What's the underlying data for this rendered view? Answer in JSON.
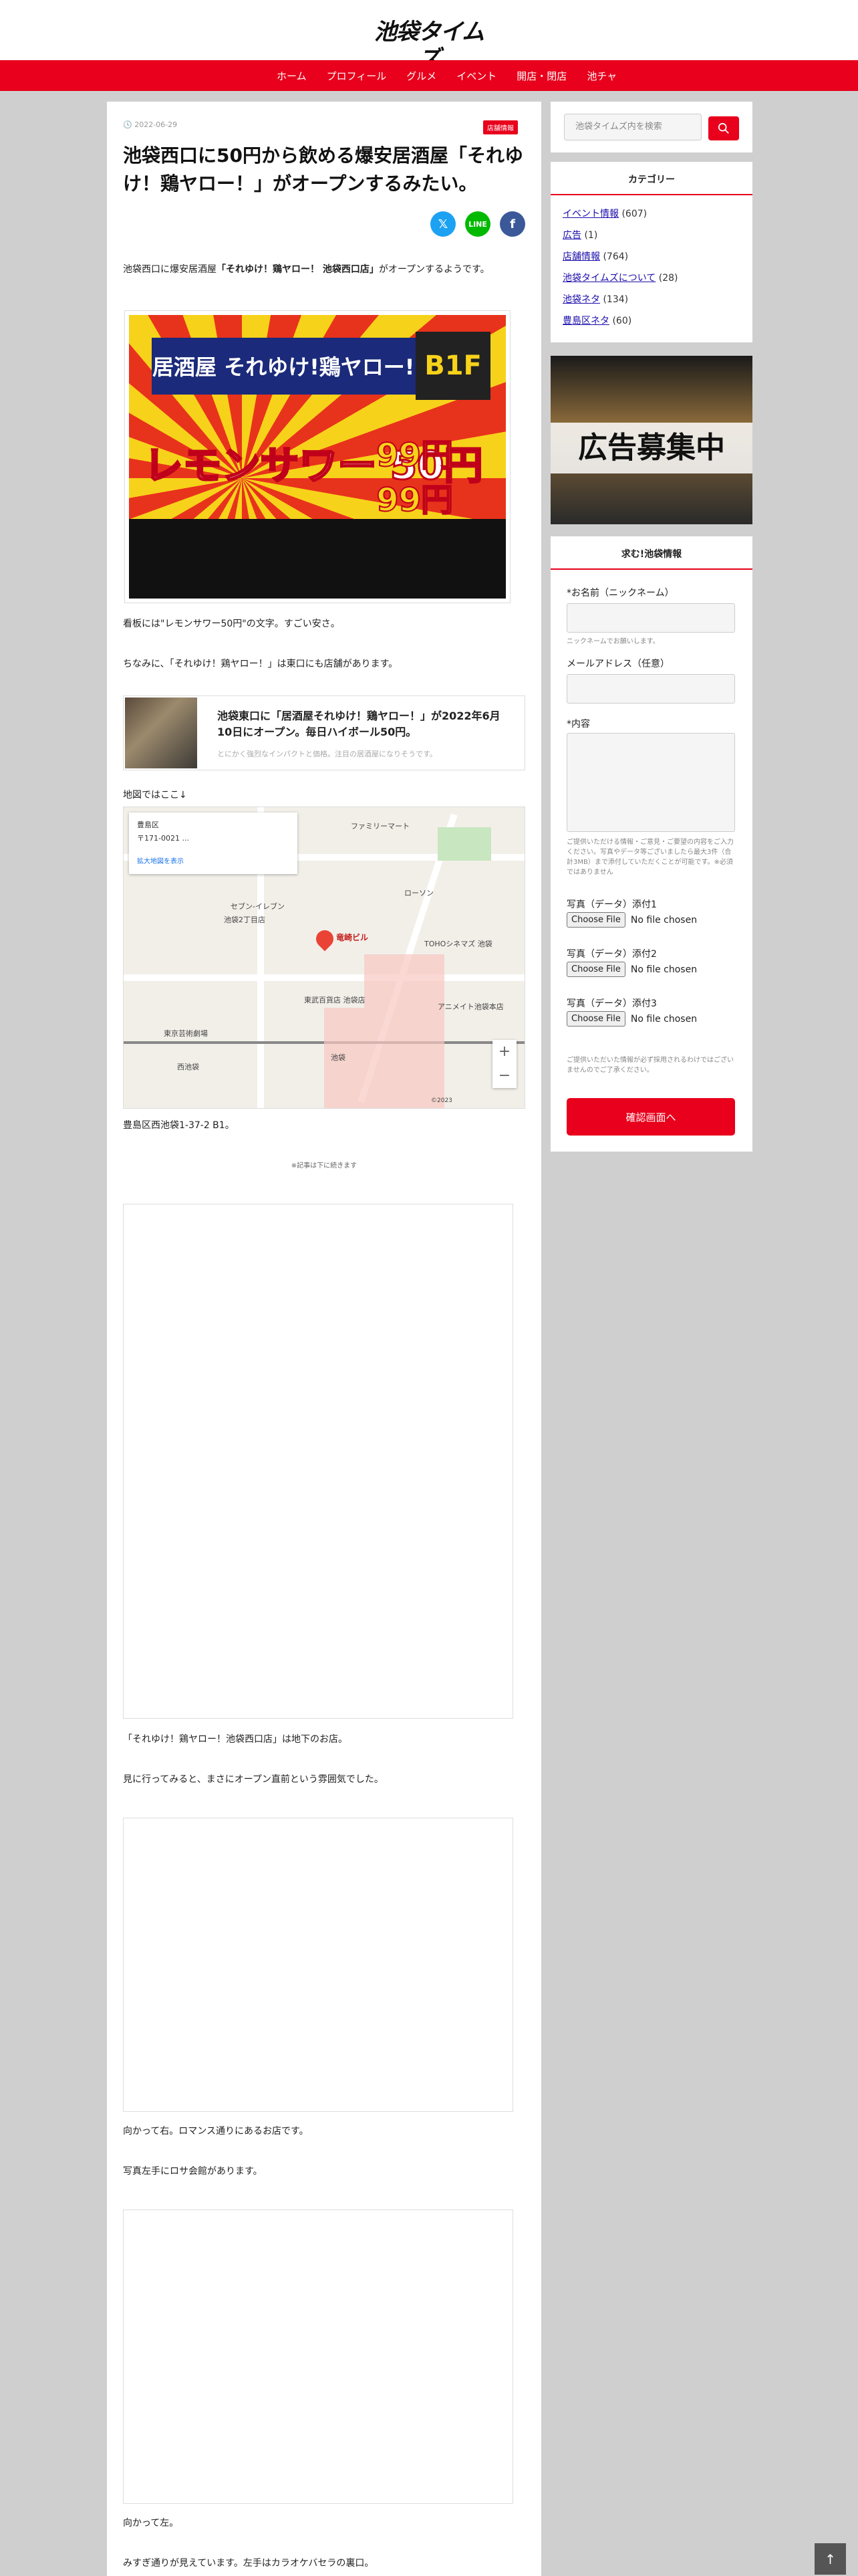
{
  "header": {
    "logo": "池袋タイムズ"
  },
  "nav": {
    "items": [
      "ホーム",
      "プロフィール",
      "グルメ",
      "イベント",
      "開店・閉店",
      "池チャ"
    ]
  },
  "post": {
    "date": "2022-06-29",
    "category": "店舗情報",
    "title": "池袋西口に50円から飲める爆安居酒屋「それゆけ！鶏ヤロー！」がオープンするみたい。",
    "intro_pre": "池袋西口に爆安居酒屋",
    "intro_bold": "「それゆけ！鶏ヤロー！ 池袋西口店」",
    "intro_post": "がオープンするようです。",
    "sign_texts": {
      "band": "居酒屋 それゆけ!鶏ヤロー!",
      "floor": "B1F",
      "sour": "レモンサワー 50円",
      "price_a": "99円",
      "price_b": "99円"
    },
    "para_sign": "看板には\"レモンサワー50円\"の文字。すごい安さ。",
    "para_east": "ちなみに、「それゆけ！鶏ヤロー！」は東口にも店舗があります。",
    "link_card": {
      "title": "池袋東口に「居酒屋それゆけ！鶏ヤロー！」が2022年6月10日にオープン。毎日ハイボール50円。",
      "desc": "とにかく強烈なインパクトと価格。注目の居酒屋になりそうです。"
    },
    "map_intro": "地図ではここ↓",
    "map": {
      "info_name": "豊島区",
      "info_postal": "〒171-0021 ...",
      "info_link": "拡大地図を表示",
      "pin_label": "竜崎ビル",
      "labels": [
        "ファミリーマート",
        "セブン-イレブン",
        "池袋2丁目店",
        "ローソン",
        "TOHOシネマズ 池袋",
        "東武百貨店 池袋店",
        "池袋",
        "西池袋",
        "東京芸術劇場",
        "アニメイト池袋本店"
      ],
      "zoom_in": "+",
      "zoom_out": "−",
      "copyright": "©2023"
    },
    "address": "豊島区西池袋1-37-2 B1。",
    "continue_note": "※記事は下に続きます",
    "para_basement": "「それゆけ！鶏ヤロー！池袋西口店」は地下のお店。",
    "para_looked": "見に行ってみると、まさにオープン直前という雰囲気でした。",
    "para_right": "向かって右。ロマンス通りにあるお店です。",
    "para_left_photo": "写真左手にロサ会館があります。",
    "para_left": "向かって左。",
    "para_misuji": "みすぎ通りが見えています。左手はカラオケバセラの裏口。"
  },
  "sidebar": {
    "search": {
      "placeholder": "池袋タイムズ内を検索"
    },
    "categories": {
      "title": "カテゴリー",
      "items": [
        {
          "name": "イベント情報",
          "count": "(607)"
        },
        {
          "name": "広告",
          "count": "(1)"
        },
        {
          "name": "店舗情報",
          "count": "(764)"
        },
        {
          "name": "池袋タイムズについて",
          "count": "(28)"
        },
        {
          "name": "池袋ネタ",
          "count": "(134)"
        },
        {
          "name": "豊島区ネタ",
          "count": "(60)"
        }
      ]
    },
    "ad": {
      "text": "広告募集中"
    },
    "form": {
      "title": "求む!池袋情報",
      "name_label": "*お名前（ニックネーム）",
      "name_hint": "ニックネームでお願いします。",
      "email_label": "メールアドレス（任意）",
      "content_label": "*内容",
      "content_hint": "ご提供いただける情報・ご意見・ご要望の内容をご入力ください。写真やデータ等ございましたら最大3件（合計3MB）まで添付していただくことが可能です。※必須ではありません",
      "file_labels": [
        "写真（データ）添付1",
        "写真（データ）添付2",
        "写真（データ）添付3"
      ],
      "file_button": "Choose File",
      "file_status": "No file chosen",
      "notice": "ご提供いただいた情報が必ず採用されるわけではございませんのでご了承ください。",
      "confirm": "確認画面へ"
    }
  },
  "to_top": "↑",
  "colors": {
    "brand": "#e8001c",
    "twitter": "#1da1f2",
    "line": "#00b900",
    "facebook": "#3b5998"
  }
}
